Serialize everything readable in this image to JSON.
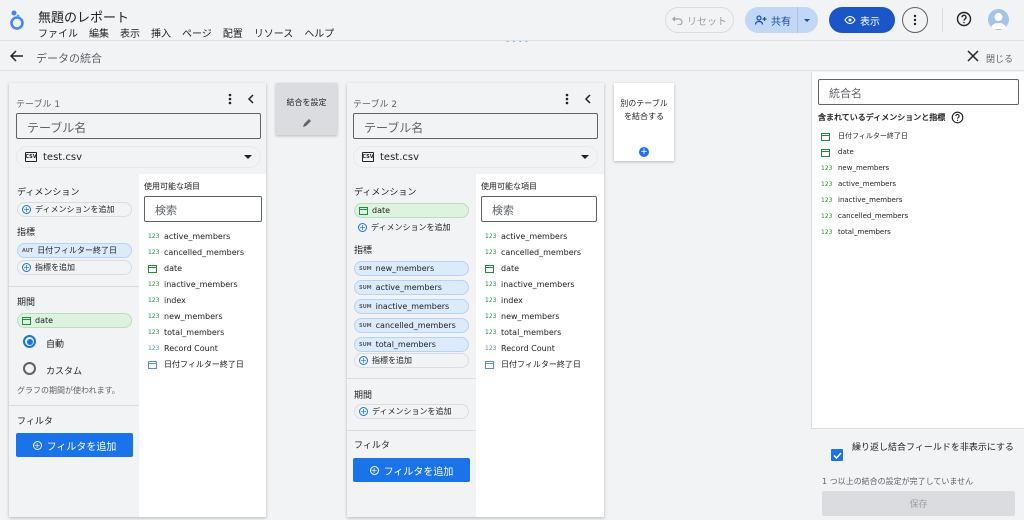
{
  "app": {
    "doc_title": "無題のレポート",
    "menu": [
      "ファイル",
      "編集",
      "表示",
      "挿入",
      "ページ",
      "配置",
      "リソース",
      "ヘルプ"
    ],
    "reset_label": "リセット",
    "share_label": "共有",
    "view_label": "表示"
  },
  "panel": {
    "title": "データの統合",
    "close_label": "閉じる"
  },
  "join": {
    "configure_label": "結合を設定",
    "add_table_label": "別のテーブルを結合する"
  },
  "table1": {
    "label": "テーブル 1",
    "name_placeholder": "テーブル名",
    "source": "test.csv",
    "dimension_header": "ディメンション",
    "add_dimension": "ディメンションを追加",
    "metric_header": "指標",
    "metric_chip": {
      "tag": "AUT",
      "label": "日付フィルター終了日"
    },
    "add_metric": "指標を追加",
    "period_header": "期間",
    "period_chip": "date",
    "radio_auto": "自動",
    "radio_custom": "カスタム",
    "period_note": "グラフの期間が使われます。",
    "filter_header": "フィルタ",
    "add_filter": "フィルタを追加",
    "available_header": "使用可能な項目",
    "search_placeholder": "検索",
    "fields": [
      {
        "type": "123",
        "label": "active_members"
      },
      {
        "type": "123",
        "label": "cancelled_members"
      },
      {
        "type": "cal",
        "label": "date"
      },
      {
        "type": "123",
        "label": "inactive_members"
      },
      {
        "type": "123",
        "label": "index"
      },
      {
        "type": "123",
        "label": "new_members"
      },
      {
        "type": "123",
        "label": "total_members"
      },
      {
        "type": "123b",
        "label": "Record Count"
      },
      {
        "type": "calb",
        "label": "日付フィルター終了日"
      }
    ]
  },
  "table2": {
    "label": "テーブル 2",
    "name_placeholder": "テーブル名",
    "source": "test.csv",
    "dimension_header": "ディメンション",
    "dimension_chip": "date",
    "add_dimension": "ディメンションを追加",
    "metric_header": "指標",
    "metric_chips": [
      "new_members",
      "active_members",
      "inactive_members",
      "cancelled_members",
      "total_members"
    ],
    "metric_tag": "SUM",
    "add_metric": "指標を追加",
    "period_header": "期間",
    "add_period_dimension": "ディメンションを追加",
    "filter_header": "フィルタ",
    "add_filter": "フィルタを追加",
    "available_header": "使用可能な項目",
    "search_placeholder": "検索",
    "fields": [
      {
        "type": "123",
        "label": "active_members"
      },
      {
        "type": "123",
        "label": "cancelled_members"
      },
      {
        "type": "cal",
        "label": "date"
      },
      {
        "type": "123",
        "label": "inactive_members"
      },
      {
        "type": "123",
        "label": "index"
      },
      {
        "type": "123",
        "label": "new_members"
      },
      {
        "type": "123",
        "label": "total_members"
      },
      {
        "type": "123b",
        "label": "Record Count"
      },
      {
        "type": "calb",
        "label": "日付フィルター終了日"
      }
    ]
  },
  "right": {
    "merge_name_placeholder": "統合名",
    "included_title": "含まれているディメンションと指標",
    "included": [
      {
        "type": "cal",
        "label": "日付フィルター終了日"
      },
      {
        "type": "cal",
        "label": "date"
      },
      {
        "type": "123",
        "label": "new_members"
      },
      {
        "type": "123",
        "label": "active_members"
      },
      {
        "type": "123",
        "label": "inactive_members"
      },
      {
        "type": "123",
        "label": "cancelled_members"
      },
      {
        "type": "123",
        "label": "total_members"
      }
    ],
    "hide_checkbox_label": "繰り返し結合フィールドを非表示にする",
    "warning": "1 つ以上の結合の設定が完了していません",
    "save_label": "保存"
  },
  "colors": {
    "accent": "#1a73e8",
    "dim_chip": "#ddf2df",
    "metric_chip": "#dcebfb"
  }
}
